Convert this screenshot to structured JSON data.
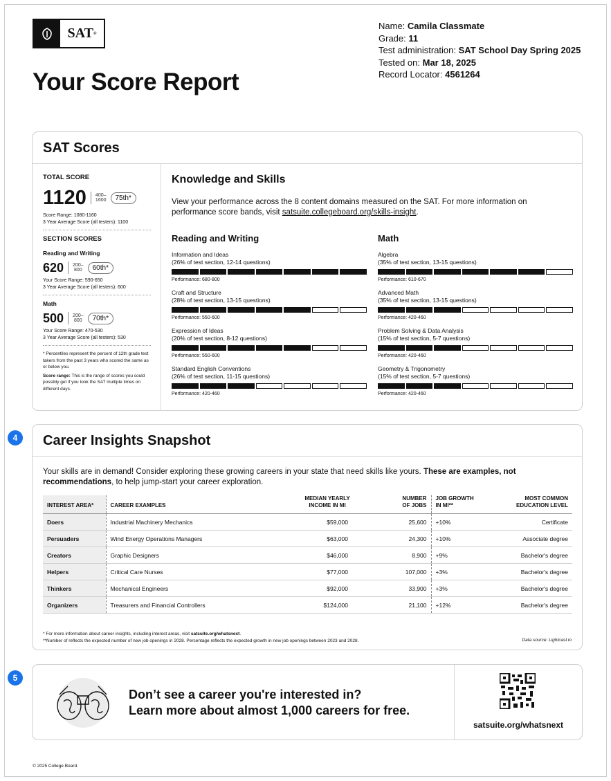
{
  "logo": {
    "text": "SAT"
  },
  "header": {
    "title": "Your Score Report",
    "student": {
      "name_label": "Name:",
      "name": "Camila Classmate",
      "grade_label": "Grade:",
      "grade": "11",
      "admin_label": "Test administration:",
      "admin": "SAT School Day Spring 2025",
      "tested_label": "Tested on:",
      "tested": "Mar 18, 2025",
      "locator_label": "Record Locator:",
      "locator": "4561264"
    }
  },
  "scores": {
    "card_title": "SAT Scores",
    "total": {
      "label": "TOTAL SCORE",
      "score": "1120",
      "range_top": "400–",
      "range_bottom": "1600",
      "percentile": "75th*",
      "score_range": "Score Range: 1080-1160",
      "avg": "3 Year Average Score (all testers): 1100"
    },
    "section_label": "SECTION SCORES",
    "sections": [
      {
        "name": "Reading and Writing",
        "score": "620",
        "range_top": "200–",
        "range_bottom": "800",
        "percentile": "60th*",
        "score_range": "Your Score Range: 590-650",
        "avg": "3 Year Average Score (all testers): 600"
      },
      {
        "name": "Math",
        "score": "500",
        "range_top": "200–",
        "range_bottom": "800",
        "percentile": "70th*",
        "score_range": "Your Score Range: 470-530",
        "avg": "3 Year Average Score (all testers): 530"
      }
    ],
    "footnote_percentile": "* Percentiles represent the percent of 12th grade test takers from the past 3 years who scored the same as or below you.",
    "footnote_range_label": "Score range:",
    "footnote_range": " This is the range of scores you could possibly get if you took the SAT multiple times on different days."
  },
  "skills": {
    "title": "Knowledge and Skills",
    "desc": "View your performance across the 8 content domains measured on the SAT. For more information on performance score bands, visit ",
    "link": "satsuite.collegeboard.org/skills-insight",
    "desc_end": ".",
    "areas": [
      {
        "name": "Reading and Writing",
        "domains": [
          {
            "name": "Information and Ideas",
            "sub": "(26% of test section, 12-14 questions)",
            "filled": 7,
            "perf": "Performance: 680-800"
          },
          {
            "name": "Craft and Structure",
            "sub": "(28% of test section, 13-15 questions)",
            "filled": 5,
            "perf": "Performance: 550-600"
          },
          {
            "name": "Expression of Ideas",
            "sub": "(20% of test section, 8-12 questions)",
            "filled": 5,
            "perf": "Performance: 550-600"
          },
          {
            "name": "Standard English Conventions",
            "sub": "(26% of test section, 11-15 questions)",
            "filled": 3,
            "perf": "Performance: 420-460"
          }
        ]
      },
      {
        "name": "Math",
        "domains": [
          {
            "name": "Algebra",
            "sub": "(35% of test section, 13-15 questions)",
            "filled": 6,
            "perf": "Performance: 610-670"
          },
          {
            "name": "Advanced Math",
            "sub": "(35% of test section, 13-15 questions)",
            "filled": 3,
            "perf": "Performance: 420-460"
          },
          {
            "name": "Problem Solving & Data Analysis",
            "sub": "(15% of test section, 5-7 questions)",
            "filled": 3,
            "perf": "Performance: 420-460"
          },
          {
            "name": "Geometry & Trigonometry",
            "sub": "(15% of test section, 5-7 questions)",
            "filled": 3,
            "perf": "Performance: 420-460"
          }
        ]
      }
    ],
    "bars_total": 7
  },
  "career": {
    "badge": "4",
    "title": "Career Insights Snapshot",
    "intro": "Your skills are in demand! Consider exploring these growing careers in your state that need skills like yours. ",
    "intro_bold": "These are examples, not recommendations",
    "intro_end": ", to help jump-start your career exploration.",
    "headers": {
      "interest": "INTEREST AREA*",
      "career": "CAREER EXAMPLES",
      "income_1": "MEDIAN YEARLY",
      "income_2": "INCOME IN MI",
      "jobs_1": "NUMBER",
      "jobs_2": "OF JOBS",
      "growth_1": "JOB GROWTH",
      "growth_2": "IN MI**",
      "edu_1": "MOST COMMON",
      "edu_2": "EDUCATION LEVEL"
    },
    "rows": [
      {
        "area": "Doers",
        "career": "Industrial Machinery Mechanics",
        "income": "$59,000",
        "jobs": "25,600",
        "growth": "+10%",
        "edu": "Certificate"
      },
      {
        "area": "Persuaders",
        "career": "Wind Energy Operations Managers",
        "income": "$63,000",
        "jobs": "24,300",
        "growth": "+10%",
        "edu": "Associate degree"
      },
      {
        "area": "Creators",
        "career": "Graphic Designers",
        "income": "$46,000",
        "jobs": "8,900",
        "growth": "+9%",
        "edu": "Bachelor's degree"
      },
      {
        "area": "Helpers",
        "career": "Critical Care Nurses",
        "income": "$77,000",
        "jobs": "107,000",
        "growth": "+3%",
        "edu": "Bachelor's degree"
      },
      {
        "area": "Thinkers",
        "career": "Mechanical Engineers",
        "income": "$92,000",
        "jobs": "33,900",
        "growth": "+3%",
        "edu": "Bachelor's degree"
      },
      {
        "area": "Organizers",
        "career": "Treasurers and Financial Controllers",
        "income": "$124,000",
        "jobs": "21,100",
        "growth": "+12%",
        "edu": "Bachelor's degree"
      }
    ],
    "foot1": "* For more information about career insights, including interest areas, visit ",
    "foot1_link": "satsuite.org/whatsnext",
    "foot1_end": ".",
    "foot2": "**Number of reflects the expected number of new job openings in 2028. Percentage reflects the expected growth in new job openings between 2023 and 2028.",
    "source": "Data source: Lightcast.io"
  },
  "promo": {
    "badge": "5",
    "line1": "Don’t see a career you're interested in?",
    "line2": "Learn more about almost 1,000 careers for free.",
    "url": "satsuite.org/whatsnext",
    "image_icon": "binoculars-icon",
    "qr_icon": "qr-code-icon"
  },
  "copyright": "© 2025 College Board."
}
